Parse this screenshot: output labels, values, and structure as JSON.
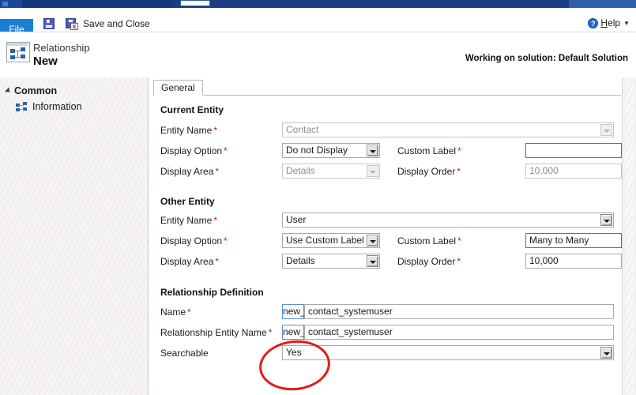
{
  "window": {
    "title_hidden": true
  },
  "ribbon": {
    "file_tab": "File",
    "save_icon": "save-icon",
    "save_close_icon": "save-and-close-icon",
    "save_and_close_label": "Save and Close",
    "help_icon": "help-icon",
    "help_label": "Help",
    "help_label_underline": "H",
    "help_label_rest": "elp",
    "help_caret": "▼"
  },
  "header": {
    "entity_icon": "relationship-icon",
    "subtitle": "Relationship",
    "title": "New",
    "solution_status": "Working on solution: Default Solution"
  },
  "sidebar": {
    "group_label": "Common",
    "group_caret": "collapse-triangle-icon",
    "items": [
      {
        "label": "Information",
        "icon": "relationship-icon"
      }
    ]
  },
  "form": {
    "tabs": [
      {
        "label": "General",
        "selected": true
      }
    ],
    "sections": [
      {
        "title": "Current Entity",
        "rows": [
          {
            "label": "Entity Name",
            "required": true,
            "control": {
              "kind": "dropdown",
              "value": "Contact",
              "disabled": true
            }
          },
          {
            "label": "Display Option",
            "required": true,
            "control": {
              "kind": "dropdown",
              "value": "Do not Display",
              "disabled": false
            },
            "label2": "Custom Label",
            "required2": true,
            "control2": {
              "kind": "text",
              "value": "",
              "disabled": false
            }
          },
          {
            "label": "Display Area",
            "required": true,
            "control": {
              "kind": "dropdown",
              "value": "Details",
              "disabled": true
            },
            "label2": "Display Order",
            "required2": true,
            "control2": {
              "kind": "text",
              "value": "10,000",
              "disabled": true
            }
          }
        ]
      },
      {
        "title": "Other Entity",
        "rows": [
          {
            "label": "Entity Name",
            "required": true,
            "control": {
              "kind": "dropdown",
              "value": "User",
              "disabled": false
            }
          },
          {
            "label": "Display Option",
            "required": true,
            "control": {
              "kind": "dropdown",
              "value": "Use Custom Label",
              "disabled": false
            },
            "label2": "Custom Label",
            "required2": true,
            "control2": {
              "kind": "text",
              "value": "Many to Many",
              "disabled": false
            }
          },
          {
            "label": "Display Area",
            "required": true,
            "control": {
              "kind": "dropdown",
              "value": "Details",
              "disabled": false
            },
            "label2": "Display Order",
            "required2": true,
            "control2": {
              "kind": "text",
              "value": "10,000",
              "disabled": false
            }
          }
        ]
      },
      {
        "title": "Relationship Definition",
        "rows": [
          {
            "label": "Name",
            "required": true,
            "control": {
              "kind": "prefixed-text",
              "prefix": "new_",
              "value": "contact_systemuser",
              "disabled": false
            }
          },
          {
            "label": "Relationship Entity Name",
            "required": true,
            "control": {
              "kind": "prefixed-text",
              "prefix": "new_",
              "value": "contact_systemuser",
              "disabled": false
            }
          },
          {
            "label": "Searchable",
            "required": false,
            "control": {
              "kind": "dropdown",
              "value": "Yes",
              "disabled": false
            }
          }
        ]
      }
    ]
  },
  "annotation": {
    "shape": "red-ellipse-highlight",
    "target": "Searchable value Yes",
    "color": "#e41a1a"
  },
  "colors": {
    "file_tab_blue": "#1a7fd4",
    "titlebar_blue": "#15387b",
    "required_red": "#cc2200",
    "annotation_red": "#e41a1a",
    "sidebar_bg": "#f3eff1"
  }
}
